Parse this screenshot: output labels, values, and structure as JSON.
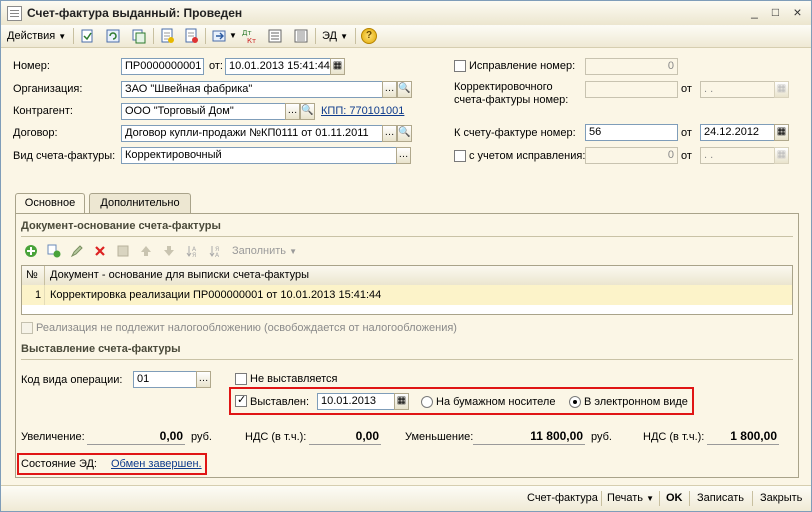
{
  "window": {
    "title": "Счет-фактура выданный: Проведен",
    "minimize": "_",
    "maximize": "□",
    "close": "×"
  },
  "toolbar": {
    "actions_label": "Действия",
    "ed_label": "ЭД",
    "help_label": "?"
  },
  "form": {
    "number_label": "Номер:",
    "number_value": "ПР0000000001",
    "date_from_label": "от:",
    "date_value": "10.01.2013 15:41:44",
    "org_label": "Организация:",
    "org_value": "ЗАО \"Швейная фабрика\"",
    "contractor_label": "Контрагент:",
    "contractor_value": "ООО \"Торговый Дом\"",
    "kpp_link": "КПП: 770101001",
    "contract_label": "Договор:",
    "contract_value": "Договор купли-продажи №КП0111 от 01.11.2011",
    "kind_label": "Вид счета-фактуры:",
    "kind_value": "Корректировочный",
    "fix_number_label": "Исправление номер:",
    "fix_number_value": "0",
    "corr_label_1": "Корректировочного",
    "corr_label_2": "счета-фактуры номер:",
    "corr_from_label": "от",
    "corr_date_placeholder": ". .",
    "to_invoice_label": "К счету-фактуре номер:",
    "to_invoice_value": "56",
    "to_invoice_from_label": "от",
    "to_invoice_date": "24.12.2012",
    "with_fix_label": "с учетом исправления:",
    "with_fix_value": "0",
    "with_fix_from_label": "от",
    "with_fix_date_placeholder": ". ."
  },
  "tabs": [
    {
      "label": "Основное"
    },
    {
      "label": "Дополнительно"
    }
  ],
  "doc_section": {
    "title": "Документ-основание счета-фактуры",
    "fill_label": "Заполнить",
    "col_num": "№",
    "col_doc": "Документ - основание для выписки счета-фактуры",
    "rows": [
      {
        "num": "1",
        "doc": "Корректировка реализации ПР000000001 от 10.01.2013 15:41:44"
      }
    ],
    "tax_exempt_label": "Реализация не подлежит налогообложению (освобождается от налогообложения)"
  },
  "issue_section": {
    "title": "Выставление счета-фактуры",
    "op_code_label": "Код вида операции:",
    "op_code_value": "01",
    "not_issued_label": "Не выставляется",
    "issued_label": "Выставлен:",
    "issued_date": "10.01.2013",
    "paper_label": "На бумажном носителе",
    "electronic_label": "В электронном виде"
  },
  "totals": {
    "increase_label": "Увеличение:",
    "increase_value": "0,00",
    "increase_cur": "руб.",
    "vat1_label": "НДС (в т.ч.):",
    "vat1_value": "0,00",
    "decrease_label": "Уменьшение:",
    "decrease_value": "11 800,00",
    "decrease_cur": "руб.",
    "vat2_label": "НДС (в т.ч.):",
    "vat2_value": "1 800,00"
  },
  "ed_state": {
    "label": "Состояние ЭД:",
    "value": "Обмен завершен."
  },
  "bottom": {
    "invoice": "Счет-фактура",
    "print": "Печать",
    "ok": "OK",
    "save": "Записать",
    "close": "Закрыть"
  },
  "colors": {
    "highlight_red": "#e01515",
    "link_blue": "#0e3b8c",
    "row_selected": "#fcf3c9"
  }
}
